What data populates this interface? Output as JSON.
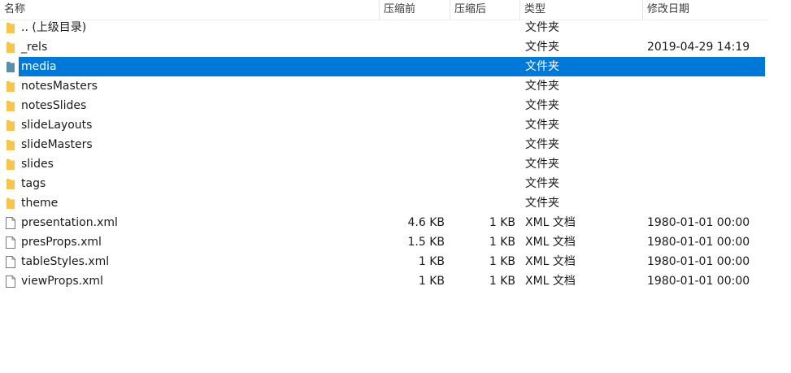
{
  "columns": {
    "name": "名称",
    "packed": "压缩前",
    "size": "压缩后",
    "type": "类型",
    "modified": "修改日期"
  },
  "colors": {
    "selection": "#0078d7",
    "folder": "#f5c54b",
    "folder_selected": "#5a8ea8"
  },
  "rows": [
    {
      "icon": "folder-icon",
      "name": ".. (上级目录)",
      "packed": "",
      "size": "",
      "type": "文件夹",
      "modified": "",
      "selected": false
    },
    {
      "icon": "folder-icon",
      "name": "_rels",
      "packed": "",
      "size": "",
      "type": "文件夹",
      "modified": "2019-04-29 14:19",
      "selected": false
    },
    {
      "icon": "folder-icon",
      "name": "media",
      "packed": "",
      "size": "",
      "type": "文件夹",
      "modified": "",
      "selected": true
    },
    {
      "icon": "folder-icon",
      "name": "notesMasters",
      "packed": "",
      "size": "",
      "type": "文件夹",
      "modified": "",
      "selected": false
    },
    {
      "icon": "folder-icon",
      "name": "notesSlides",
      "packed": "",
      "size": "",
      "type": "文件夹",
      "modified": "",
      "selected": false
    },
    {
      "icon": "folder-icon",
      "name": "slideLayouts",
      "packed": "",
      "size": "",
      "type": "文件夹",
      "modified": "",
      "selected": false
    },
    {
      "icon": "folder-icon",
      "name": "slideMasters",
      "packed": "",
      "size": "",
      "type": "文件夹",
      "modified": "",
      "selected": false
    },
    {
      "icon": "folder-icon",
      "name": "slides",
      "packed": "",
      "size": "",
      "type": "文件夹",
      "modified": "",
      "selected": false
    },
    {
      "icon": "folder-icon",
      "name": "tags",
      "packed": "",
      "size": "",
      "type": "文件夹",
      "modified": "",
      "selected": false
    },
    {
      "icon": "folder-icon",
      "name": "theme",
      "packed": "",
      "size": "",
      "type": "文件夹",
      "modified": "",
      "selected": false
    },
    {
      "icon": "file-icon",
      "name": "presentation.xml",
      "packed": "4.6 KB",
      "size": "1 KB",
      "type": "XML 文档",
      "modified": "1980-01-01 00:00",
      "selected": false
    },
    {
      "icon": "file-icon",
      "name": "presProps.xml",
      "packed": "1.5 KB",
      "size": "1 KB",
      "type": "XML 文档",
      "modified": "1980-01-01 00:00",
      "selected": false
    },
    {
      "icon": "file-icon",
      "name": "tableStyles.xml",
      "packed": "1 KB",
      "size": "1 KB",
      "type": "XML 文档",
      "modified": "1980-01-01 00:00",
      "selected": false
    },
    {
      "icon": "file-icon",
      "name": "viewProps.xml",
      "packed": "1 KB",
      "size": "1 KB",
      "type": "XML 文档",
      "modified": "1980-01-01 00:00",
      "selected": false
    }
  ]
}
